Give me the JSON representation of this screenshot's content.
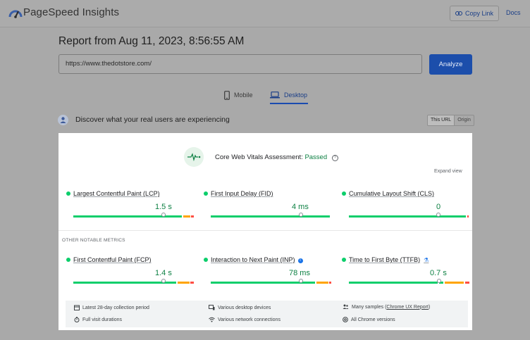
{
  "header": {
    "brand": "PageSpeed Insights",
    "copy_link": "Copy Link",
    "docs": "Docs"
  },
  "report": {
    "title": "Report from Aug 11, 2023, 8:56:55 AM",
    "url_value": "https://www.thedotstore.com/",
    "analyze_label": "Analyze"
  },
  "tabs": [
    {
      "label": "Mobile",
      "active": false
    },
    {
      "label": "Desktop",
      "active": true
    }
  ],
  "discover": {
    "text": "Discover what your real users are experiencing",
    "segments": [
      "This URL",
      "Origin"
    ]
  },
  "assessment": {
    "prefix": "Core Web Vitals Assessment:",
    "status": "Passed",
    "expand": "Expand view"
  },
  "core_metrics": [
    {
      "name": "Largest Contentful Paint (LCP)",
      "value": "1.5 s"
    },
    {
      "name": "First Input Delay (FID)",
      "value": "4 ms"
    },
    {
      "name": "Cumulative Layout Shift (CLS)",
      "value": "0"
    }
  ],
  "other_label": "OTHER NOTABLE METRICS",
  "other_metrics": [
    {
      "name": "First Contentful Paint (FCP)",
      "value": "1.4 s"
    },
    {
      "name": "Interaction to Next Paint (INP)",
      "value": "78 ms"
    },
    {
      "name": "Time to First Byte (TTFB)",
      "value": "0.7 s"
    }
  ],
  "footer": {
    "period": "Latest 28-day collection period",
    "visits": "Full visit durations",
    "devices": "Various desktop devices",
    "network": "Various network connections",
    "samples_prefix": "Many samples (",
    "samples_link": "Chrome UX Report",
    "samples_suffix": ")",
    "chrome": "All Chrome versions"
  },
  "colors": {
    "good": "#0cce6b",
    "needs_improvement": "#ffa400",
    "poor": "#ff4e42",
    "accent": "#1a73e8"
  }
}
